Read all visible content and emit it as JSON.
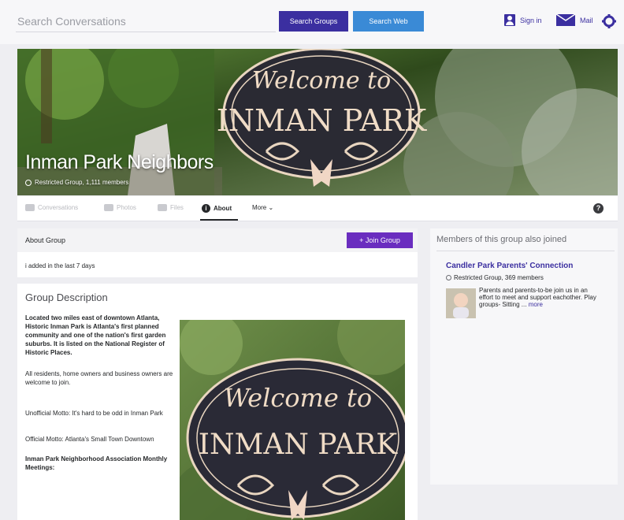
{
  "search": {
    "placeholder": "Search Conversations"
  },
  "header": {
    "search_groups_label": "Search Groups",
    "search_web_label": "Search Web",
    "signin_label": "Sign in",
    "mail_label": "Mail"
  },
  "banner": {
    "group_name": "Inman Park Neighbors",
    "group_meta": "Restricted Group, 1,111 members",
    "sign_line1": "Welcome to",
    "sign_line2": "INMAN PARK"
  },
  "tabs": {
    "conversations": "Conversations",
    "photos": "Photos",
    "files": "Files",
    "about": "About",
    "more": "More ⌄"
  },
  "about": {
    "title": "About Group",
    "join_label": "+ Join Group",
    "added_text": "i added in the last 7 days"
  },
  "description": {
    "title": "Group Description",
    "p1": "Located two miles east of downtown Atlanta, Historic Inman Park is Atlanta's first planned community and one of the nation's first garden suburbs. It is listed on the National Register of Historic Places.",
    "p2": "All residents, home owners and business owners are welcome to join.",
    "p3": "Unofficial Motto: It's hard to be odd in Inman Park",
    "p4": "Official Motto: Atlanta's Small Town Downtown",
    "p5": "Inman Park Neighborhood Association Monthly Meetings:"
  },
  "members": {
    "heading": "Members of this group also joined",
    "group_name": "Candler Park Parents' Connection",
    "group_meta": "Restricted Group, 369 members",
    "group_desc": "Parents and parents-to-be join us in an effort to meet and support eachother. Play groups- Sitting ...",
    "more_label": "more"
  },
  "colors": {
    "brand_purple": "#3b2fa0",
    "web_blue": "#3a8ad6",
    "join_purple": "#6a2dbf"
  },
  "icons": [
    "signin-icon",
    "mail-icon",
    "gear-icon",
    "help-icon",
    "about-icon"
  ]
}
